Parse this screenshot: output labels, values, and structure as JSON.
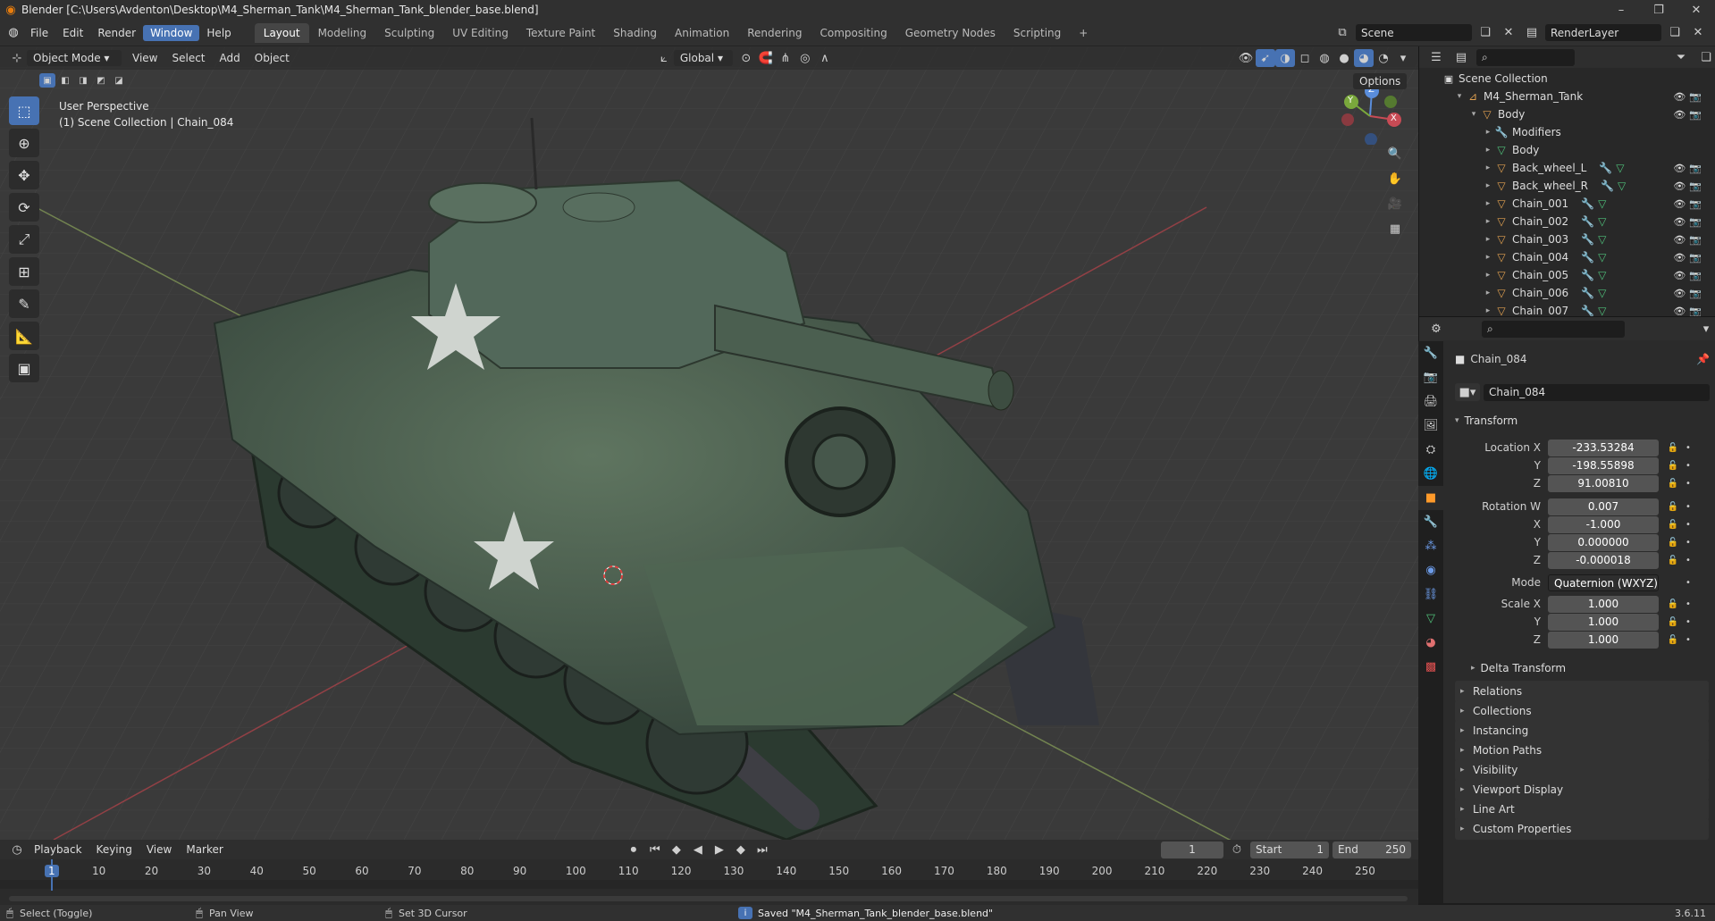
{
  "window": {
    "title": "Blender [C:\\Users\\Avdenton\\Desktop\\M4_Sherman_Tank\\M4_Sherman_Tank_blender_base.blend]",
    "controls": [
      "–",
      "❐",
      "✕"
    ]
  },
  "menus": [
    "File",
    "Edit",
    "Render",
    "Window",
    "Help"
  ],
  "active_menu": "Window",
  "workspaces": [
    "Layout",
    "Modeling",
    "Sculpting",
    "UV Editing",
    "Texture Paint",
    "Shading",
    "Animation",
    "Rendering",
    "Compositing",
    "Geometry Nodes",
    "Scripting",
    "+"
  ],
  "active_workspace": "Layout",
  "scene": {
    "name": "Scene",
    "view_layer": "RenderLayer"
  },
  "viewport": {
    "mode": "Object Mode",
    "menus": [
      "View",
      "Select",
      "Add",
      "Object"
    ],
    "orientation": "Global",
    "options_label": "Options",
    "overlay_line1": "User Perspective",
    "overlay_line2": "(1) Scene Collection | Chain_084",
    "gizmo_axes": {
      "x": "X",
      "y": "Y",
      "z": "Z"
    }
  },
  "outliner": {
    "root": "Scene Collection",
    "rows": [
      {
        "label": "M4_Sherman_Tank",
        "depth": 1,
        "kind": "collection"
      },
      {
        "label": "Body",
        "depth": 2,
        "kind": "object"
      },
      {
        "label": "Modifiers",
        "depth": 3,
        "kind": "modifiers"
      },
      {
        "label": "Body",
        "depth": 3,
        "kind": "mesh"
      },
      {
        "label": "Back_wheel_L",
        "depth": 3,
        "kind": "object"
      },
      {
        "label": "Back_wheel_R",
        "depth": 3,
        "kind": "object"
      },
      {
        "label": "Chain_001",
        "depth": 3,
        "kind": "object"
      },
      {
        "label": "Chain_002",
        "depth": 3,
        "kind": "object"
      },
      {
        "label": "Chain_003",
        "depth": 3,
        "kind": "object"
      },
      {
        "label": "Chain_004",
        "depth": 3,
        "kind": "object"
      },
      {
        "label": "Chain_005",
        "depth": 3,
        "kind": "object"
      },
      {
        "label": "Chain_006",
        "depth": 3,
        "kind": "object"
      },
      {
        "label": "Chain_007",
        "depth": 3,
        "kind": "object"
      }
    ]
  },
  "properties": {
    "object_name": "Chain_084",
    "datablock_name": "Chain_084",
    "transform_label": "Transform",
    "location": {
      "label": "Location X",
      "x": "-233.53284",
      "y": "-198.55898",
      "z": "91.00810"
    },
    "rotation": {
      "label": "Rotation W",
      "w": "0.007",
      "x": "-1.000",
      "y": "0.000000",
      "z": "-0.000018"
    },
    "mode": {
      "label": "Mode",
      "value": "Quaternion (WXYZ)"
    },
    "scale": {
      "label": "Scale X",
      "x": "1.000",
      "y": "1.000",
      "z": "1.000"
    },
    "axis_labels": {
      "y": "Y",
      "z": "Z",
      "x": "X"
    },
    "delta_transform": "Delta Transform",
    "panels": [
      "Relations",
      "Collections",
      "Instancing",
      "Motion Paths",
      "Visibility",
      "Viewport Display",
      "Line Art",
      "Custom Properties"
    ]
  },
  "timeline": {
    "menus": [
      "Playback",
      "Keying",
      "View",
      "Marker"
    ],
    "current_frame": "1",
    "start_label": "Start",
    "start": "1",
    "end_label": "End",
    "end": "250",
    "ticks": [
      "1",
      "10",
      "20",
      "30",
      "40",
      "50",
      "60",
      "70",
      "80",
      "90",
      "100",
      "110",
      "120",
      "130",
      "140",
      "150",
      "160",
      "170",
      "180",
      "190",
      "200",
      "210",
      "220",
      "230",
      "240",
      "250"
    ]
  },
  "status": {
    "select": "Select (Toggle)",
    "pan": "Pan View",
    "cursor": "Set 3D Cursor",
    "message": "Saved \"M4_Sherman_Tank_blender_base.blend\"",
    "version": "3.6.11"
  },
  "colors": {
    "accent": "#4772b3",
    "orange": "#e87d0d",
    "tank_green": "#4a5e4a"
  }
}
